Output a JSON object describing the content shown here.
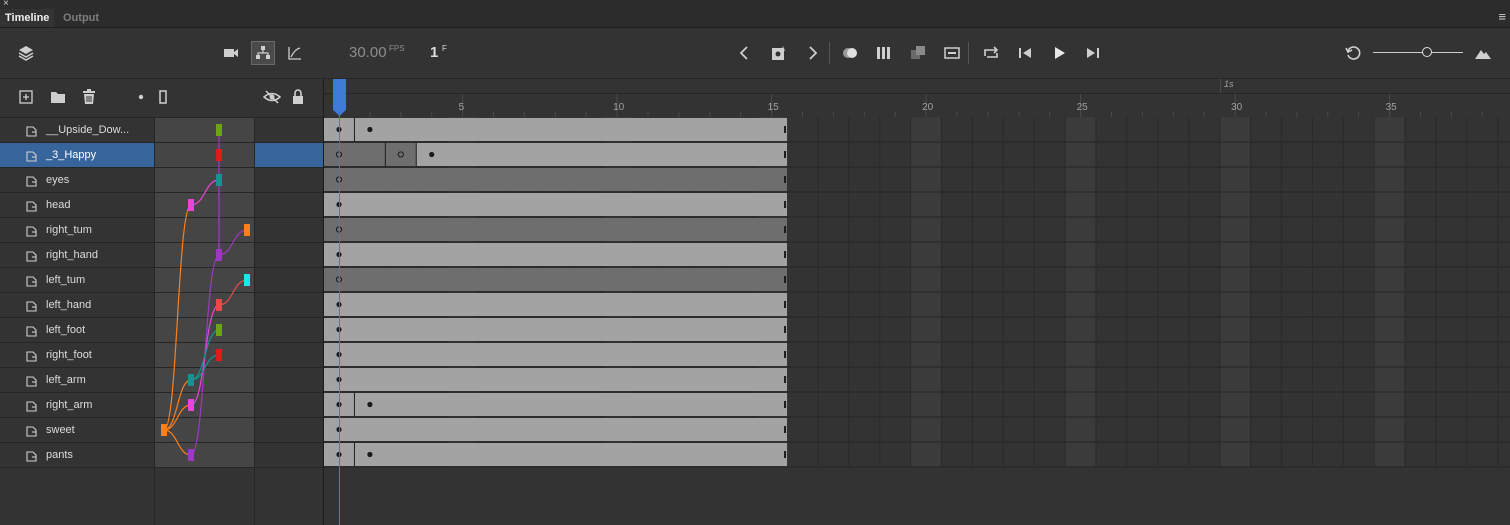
{
  "panel": {
    "close_glyph": "×",
    "menu_glyph": "≡",
    "tabs": [
      {
        "label": "Timeline"
      },
      {
        "label": "Output"
      }
    ]
  },
  "toolbar": {
    "fps_value": "30.00",
    "fps_unit": "FPS",
    "frame_value": "1",
    "frame_unit": "F",
    "icons": [
      "layers-icon",
      "camera-icon",
      "layer-parenting-icon",
      "graph-icon",
      "prev-keyframe-icon",
      "insert-keyframe-icon",
      "next-keyframe-icon",
      "onion-skin-icon",
      "onion-outline-icon",
      "edit-multiple-frames-icon",
      "clip-frames-icon",
      "loop-icon",
      "step-back-icon",
      "play-icon",
      "step-forward-icon",
      "reset-zoom-icon",
      "zoom-slider",
      "mountain-icon"
    ],
    "zoom_level": 0.6
  },
  "layer_toolbar": {
    "icons": [
      "new-layer-icon",
      "new-folder-icon",
      "delete-icon",
      "dot-icon",
      "outline-icon",
      "visibility-icon",
      "lock-icon"
    ]
  },
  "layers": [
    {
      "name": "__Upside_Dow...",
      "selected": false
    },
    {
      "name": "_3_Happy",
      "selected": true
    },
    {
      "name": "eyes",
      "selected": false
    },
    {
      "name": "head",
      "selected": false
    },
    {
      "name": "right_tum",
      "selected": false
    },
    {
      "name": "right_hand",
      "selected": false
    },
    {
      "name": "left_tum",
      "selected": false
    },
    {
      "name": "left_hand",
      "selected": false
    },
    {
      "name": "left_foot",
      "selected": false
    },
    {
      "name": "right_foot",
      "selected": false
    },
    {
      "name": "left_arm",
      "selected": false
    },
    {
      "name": "right_arm",
      "selected": false
    },
    {
      "name": "sweet",
      "selected": false
    },
    {
      "name": "pants",
      "selected": false
    }
  ],
  "parent_markers": [
    {
      "layer": "__Upside_Dow...",
      "color": "#6fa21b"
    },
    {
      "layer": "_3_Happy",
      "color": "#e21a1a"
    },
    {
      "layer": "eyes",
      "color": "#1a9191"
    },
    {
      "layer": "head",
      "color": "#e846d8"
    },
    {
      "layer": "right_tum",
      "color": "#ff7f1a"
    },
    {
      "layer": "right_hand",
      "color": "#9d38c3"
    },
    {
      "layer": "left_tum",
      "color": "#1ae8e8"
    },
    {
      "layer": "left_hand",
      "color": "#e84a4a"
    },
    {
      "layer": "left_foot",
      "color": "#6fa21b"
    },
    {
      "layer": "right_foot",
      "color": "#e21a1a"
    },
    {
      "layer": "left_arm",
      "color": "#1a9191"
    },
    {
      "layer": "right_arm",
      "color": "#e846d8"
    },
    {
      "layer": "sweet",
      "color": "#ff7f1a"
    },
    {
      "layer": "pants",
      "color": "#9d38c3"
    }
  ],
  "ruler": {
    "labels": [
      "5",
      "10",
      "15",
      "20",
      "25",
      "30",
      "35"
    ],
    "seconds_label": "1s"
  },
  "timeline": {
    "current_frame": 1,
    "last_frame": 15,
    "keyframes": [
      [
        {
          "frame": 1,
          "type": "key"
        },
        {
          "frame": 2,
          "type": "key"
        }
      ],
      [
        {
          "frame": 1,
          "type": "empty"
        },
        {
          "frame": 3,
          "type": "empty"
        },
        {
          "frame": 4,
          "type": "key"
        }
      ],
      [
        {
          "frame": 1,
          "type": "empty"
        }
      ],
      [
        {
          "frame": 1,
          "type": "key"
        }
      ],
      [
        {
          "frame": 1,
          "type": "empty"
        }
      ],
      [
        {
          "frame": 1,
          "type": "key"
        }
      ],
      [
        {
          "frame": 1,
          "type": "empty"
        }
      ],
      [
        {
          "frame": 1,
          "type": "key"
        }
      ],
      [
        {
          "frame": 1,
          "type": "key"
        }
      ],
      [
        {
          "frame": 1,
          "type": "key"
        }
      ],
      [
        {
          "frame": 1,
          "type": "key"
        }
      ],
      [
        {
          "frame": 1,
          "type": "key"
        },
        {
          "frame": 2,
          "type": "key"
        }
      ],
      [
        {
          "frame": 1,
          "type": "key"
        }
      ],
      [
        {
          "frame": 1,
          "type": "key"
        },
        {
          "frame": 2,
          "type": "key"
        }
      ]
    ],
    "span_colors": {
      "key": "#a3a3a3",
      "empty": "#6e6e6e",
      "alt_bg": "#3b3b3b",
      "base_bg": "#333333"
    }
  }
}
